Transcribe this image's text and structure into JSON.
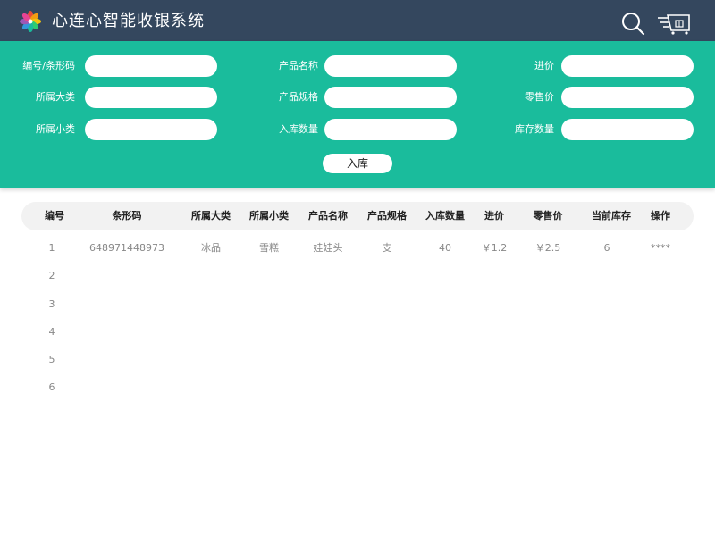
{
  "app": {
    "title": "心连心智能收银系统"
  },
  "icons": {
    "logo": "pinwheel-logo",
    "search": "search-icon",
    "cart": "cart-icon"
  },
  "colors": {
    "topbar": "#34475e",
    "accent": "#1abc9c"
  },
  "form": {
    "fields": [
      {
        "label": "编号/条形码",
        "value": ""
      },
      {
        "label": "产品名称",
        "value": ""
      },
      {
        "label": "进价",
        "value": ""
      },
      {
        "label": "所属大类",
        "value": ""
      },
      {
        "label": "产品规格",
        "value": ""
      },
      {
        "label": "零售价",
        "value": ""
      },
      {
        "label": "所属小类",
        "value": ""
      },
      {
        "label": "入库数量",
        "value": ""
      },
      {
        "label": "库存数量",
        "value": ""
      }
    ],
    "submit_label": "入库"
  },
  "table": {
    "headers": [
      "编号",
      "条形码",
      "所属大类",
      "所属小类",
      "产品名称",
      "产品规格",
      "入库数量",
      "进价",
      "零售价",
      "当前库存",
      "操作"
    ],
    "rows": [
      [
        "1",
        "648971448973",
        "冰品",
        "雪糕",
        "娃娃头",
        "支",
        "40",
        "￥1.2",
        "￥2.5",
        "6",
        "****"
      ],
      [
        "2",
        "",
        "",
        "",
        "",
        "",
        "",
        "",
        "",
        "",
        ""
      ],
      [
        "3",
        "",
        "",
        "",
        "",
        "",
        "",
        "",
        "",
        "",
        ""
      ],
      [
        "4",
        "",
        "",
        "",
        "",
        "",
        "",
        "",
        "",
        "",
        ""
      ],
      [
        "5",
        "",
        "",
        "",
        "",
        "",
        "",
        "",
        "",
        "",
        ""
      ],
      [
        "6",
        "",
        "",
        "",
        "",
        "",
        "",
        "",
        "",
        "",
        ""
      ]
    ]
  }
}
